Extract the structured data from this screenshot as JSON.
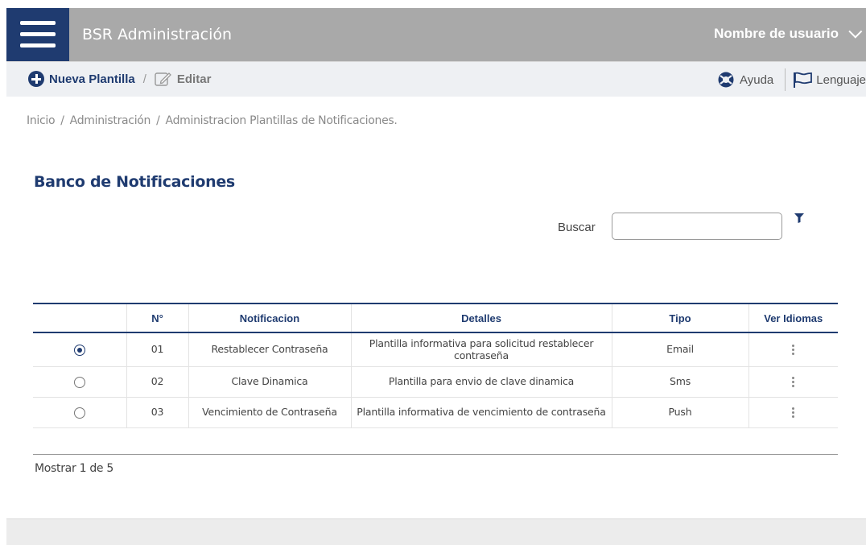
{
  "header": {
    "app_title": "BSR Administración",
    "user_menu_label": "Nombre de usuario",
    "menu_icon": "hamburger-menu-icon",
    "bg_color": "#a9a9a9",
    "brand_color": "#1f3b70"
  },
  "actionbar": {
    "new_label": "Nueva Plantilla",
    "separator": "/",
    "edit_label": "Editar",
    "help_label": "Ayuda",
    "language_label": "Lenguaje"
  },
  "breadcrumb": [
    "Inicio",
    "Administración",
    "Administracion Plantillas de Notificaciones."
  ],
  "breadcrumb_separator": "/",
  "section_title": "Banco de Notificaciones",
  "search": {
    "label": "Buscar",
    "value": ""
  },
  "table": {
    "columns": [
      "",
      "N°",
      "Notificacion",
      "Detalles",
      "Tipo",
      "Ver Idiomas"
    ],
    "rows": [
      {
        "selected": true,
        "num": "01",
        "notificacion": "Restablecer Contraseña",
        "detalles": "Plantilla informativa para solicitud restablecer contraseña",
        "tipo": "Email"
      },
      {
        "selected": false,
        "num": "02",
        "notificacion": "Clave Dinamica",
        "detalles": "Plantilla para envio de clave dinamica",
        "tipo": "Sms"
      },
      {
        "selected": false,
        "num": "03",
        "notificacion": "Vencimiento de Contraseña",
        "detalles": "Plantilla informativa de vencimiento de contraseña",
        "tipo": "Push"
      }
    ]
  },
  "pagination": {
    "label": "Mostrar 1 de 5"
  }
}
